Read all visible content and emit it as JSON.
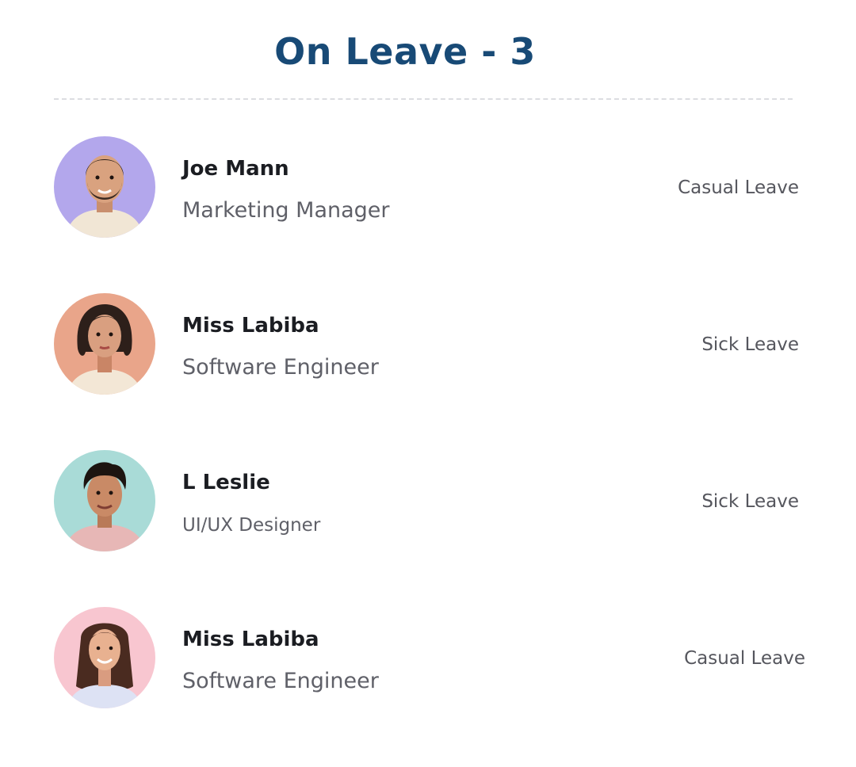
{
  "header": {
    "title": "On Leave - 3"
  },
  "colors": {
    "title": "#184a76",
    "name": "#1b1d22",
    "role": "#5f6068",
    "leave_type": "#55565d",
    "divider": "#dcdde1"
  },
  "employees": [
    {
      "name": "Joe Mann",
      "role": "Marketing Manager",
      "leave_type": "Casual Leave",
      "avatar_icon": "man-with-beard-avatar",
      "avatar_bg": "#b3a7ec"
    },
    {
      "name": "Miss Labiba",
      "role": "Software Engineer",
      "leave_type": "Sick Leave",
      "avatar_icon": "woman-with-bob-haircut-avatar",
      "avatar_bg": "#e9a58a"
    },
    {
      "name": "L Leslie",
      "role": "UI/UX Designer",
      "leave_type": "Sick Leave",
      "avatar_icon": "man-smiling-avatar",
      "avatar_bg": "#a9dbd7"
    },
    {
      "name": "Miss Labiba",
      "role": "Software Engineer",
      "leave_type": "Casual Leave",
      "avatar_icon": "woman-with-long-hair-avatar",
      "avatar_bg": "#f8c6d0"
    }
  ]
}
